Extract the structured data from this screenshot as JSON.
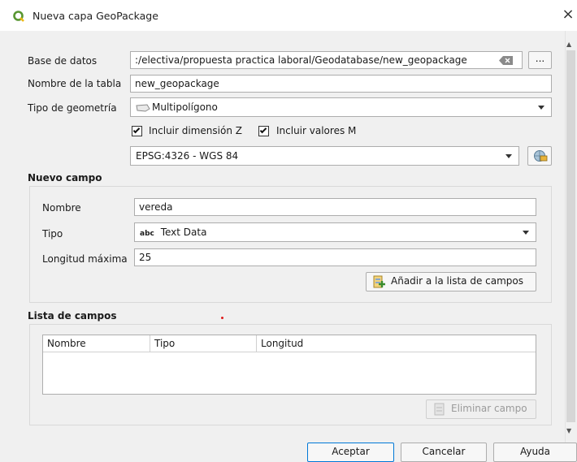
{
  "window": {
    "title": "Nueva capa GeoPackage",
    "close_glyph": "×",
    "icon": "qgis-icon",
    "accent_color": "#0078d7"
  },
  "database": {
    "label": "Base de datos",
    "value": ":/electiva/propuesta practica laboral/Geodatabase/new_geopackage",
    "clear_icon": "clear-input-icon",
    "browse_label": "..."
  },
  "table_name": {
    "label": "Nombre de la tabla",
    "value": "new_geopackage"
  },
  "geometry": {
    "label": "Tipo de geometría",
    "value": "Multipolígono",
    "icon": "polygon-icon",
    "include_z_label": "Incluir dimensión Z",
    "include_z_checked": true,
    "include_m_label": "Incluir valores M",
    "include_m_checked": true
  },
  "crs": {
    "value": "EPSG:4326 - WGS 84",
    "selector_icon": "crs-globe-icon"
  },
  "new_field": {
    "section_title": "Nuevo campo",
    "name_label": "Nombre",
    "name_value": "vereda",
    "type_label": "Tipo",
    "type_prefix": "abc",
    "type_value": "Text Data",
    "max_length_label": "Longitud máxima",
    "max_length_value": "25",
    "add_button_label": "Añadir a la lista de campos",
    "add_icon": "add-field-icon"
  },
  "field_list": {
    "section_title": "Lista de campos",
    "columns": [
      "Nombre",
      "Tipo",
      "Longitud"
    ],
    "rows": [],
    "remove_button_label": "Eliminar campo",
    "remove_icon": "remove-field-icon"
  },
  "footer": {
    "ok_label": "Aceptar",
    "cancel_label": "Cancelar",
    "help_label": "Ayuda"
  }
}
